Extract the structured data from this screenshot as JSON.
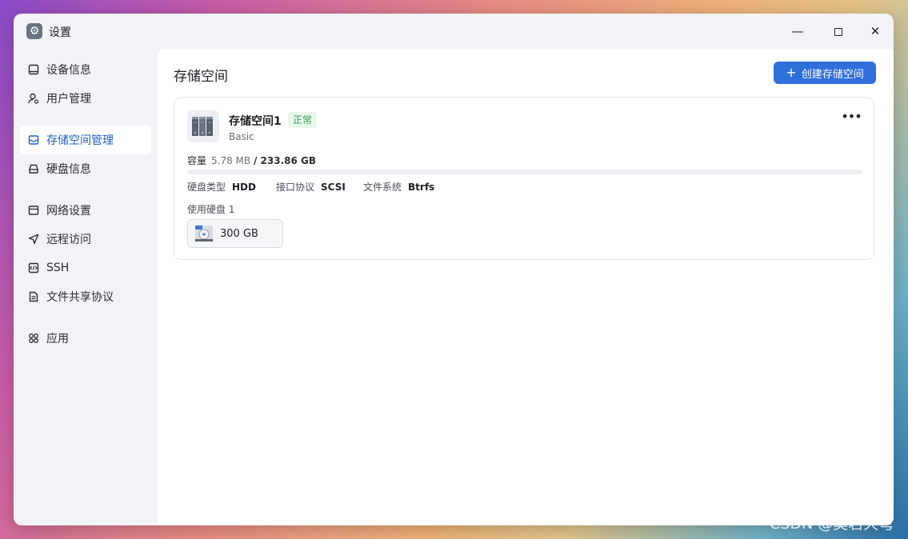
{
  "window": {
    "title": "设置"
  },
  "sidebar": {
    "items": [
      {
        "label": "设备信息",
        "icon": "device-icon"
      },
      {
        "label": "用户管理",
        "icon": "user-gear-icon"
      },
      {
        "label": "存储空间管理",
        "icon": "storage-icon",
        "active": true
      },
      {
        "label": "硬盘信息",
        "icon": "disk-icon"
      },
      {
        "label": "网络设置",
        "icon": "network-icon"
      },
      {
        "label": "远程访问",
        "icon": "send-icon"
      },
      {
        "label": "SSH",
        "icon": "terminal-icon"
      },
      {
        "label": "文件共享协议",
        "icon": "file-icon"
      },
      {
        "label": "应用",
        "icon": "apps-icon"
      }
    ]
  },
  "main": {
    "title": "存储空间",
    "create_button": "创建存储空间",
    "volume": {
      "name": "存储空间1",
      "status": "正常",
      "type": "Basic",
      "capacity_label": "容量",
      "used": "5.78 MB",
      "total": "/ 233.86 GB",
      "usage_fraction": 0.0,
      "disk_type_label": "硬盘类型",
      "disk_type": "HDD",
      "interface_label": "接口协议",
      "interface": "SCSI",
      "filesystem_label": "文件系统",
      "filesystem": "Btrfs",
      "disks_label": "使用硬盘 1",
      "disk_size": "300 GB"
    }
  },
  "colors": {
    "accent": "#2f6fdc",
    "status_ok": "#2ea44f"
  },
  "watermark": "CSDN @莫若天穹"
}
